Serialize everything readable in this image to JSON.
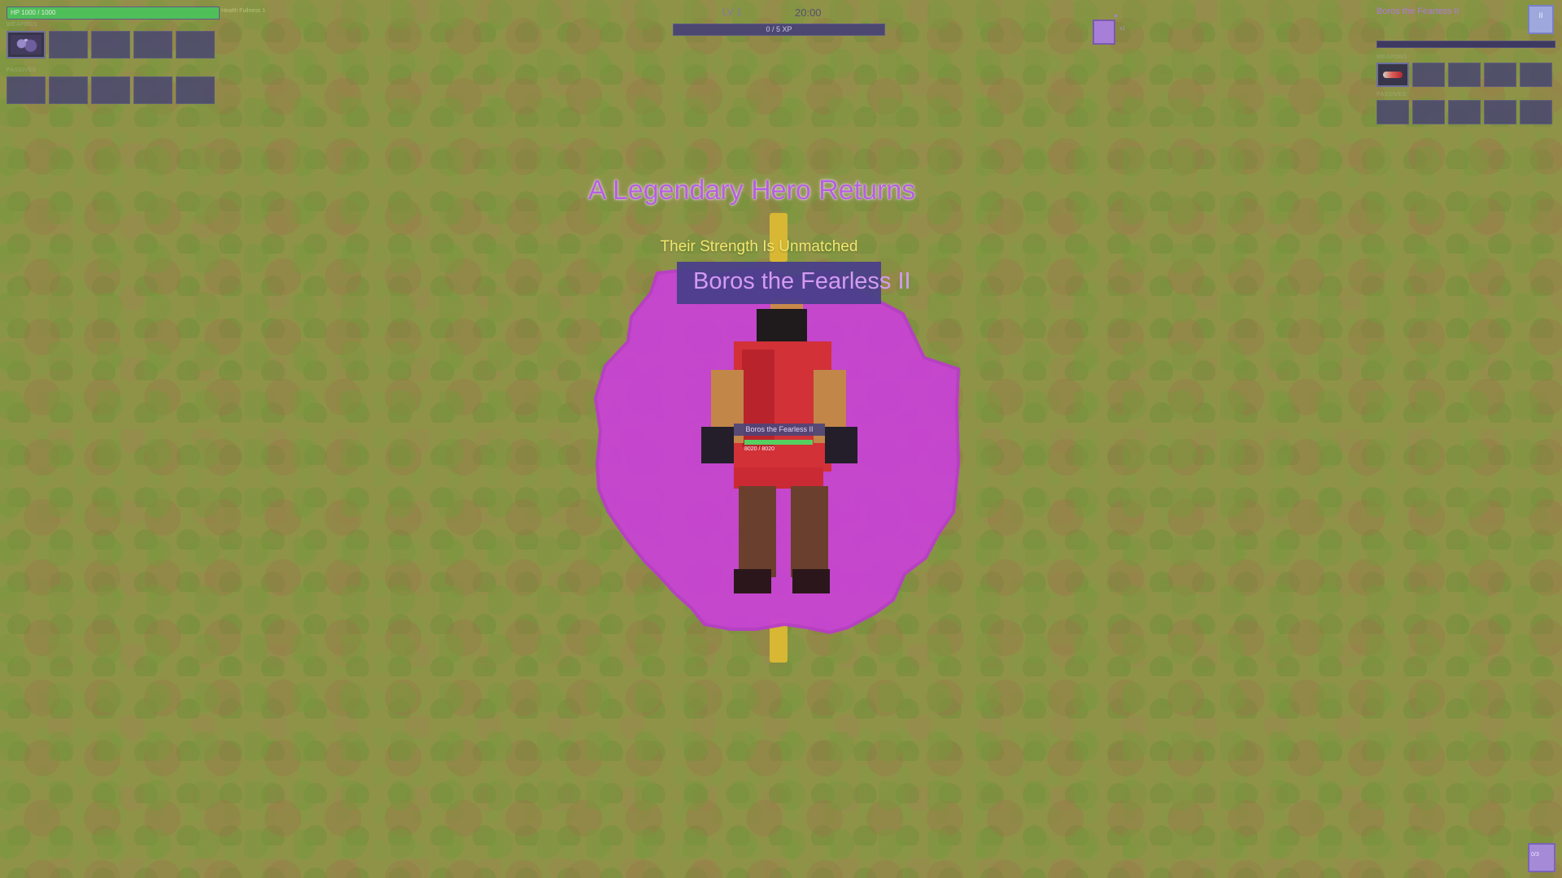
{
  "hud": {
    "hp_text": "HP 1000 / 1000",
    "hp_fraction": 1.0,
    "hp_extra": "Health Fullness 1",
    "weapons_label": "WEAPONS",
    "weapon_slots": [
      "filled",
      "empty",
      "empty",
      "empty",
      "empty"
    ],
    "passives_label": "PASSIVES",
    "passive_slots": [
      "empty",
      "empty",
      "empty",
      "empty",
      "empty"
    ]
  },
  "top": {
    "level": "LV 1",
    "timer": "20:00",
    "xp_text": "0 / 5 XP",
    "xp_fraction": 0.0,
    "square_label": "x1"
  },
  "boss_panel": {
    "name": "Boros the Fearless II",
    "portrait_glyph": "II",
    "hp_fraction": 1.0,
    "weapons_label": "WEAPONS",
    "weapon_slots": [
      "filled",
      "empty",
      "empty",
      "empty",
      "empty"
    ],
    "passives_label": "PASSIVES",
    "passive_slots": [
      "empty",
      "empty",
      "empty",
      "empty",
      "empty"
    ]
  },
  "event": {
    "title": "A Legendary Hero Returns",
    "subtitle": "Their Strength Is Unmatched",
    "name": "Boros the Fearless II"
  },
  "hero": {
    "name": "Boros the Fearless II",
    "hp_text": "8020 / 8020",
    "hp_fraction": 1.0
  },
  "corner_button": {
    "label": "0/3"
  },
  "colors": {
    "accent_purple": "#b75fe0",
    "aura_magenta": "#c744d2",
    "subtitle_yellow": "#f2e76f",
    "hp_green": "#4fbf5a"
  }
}
